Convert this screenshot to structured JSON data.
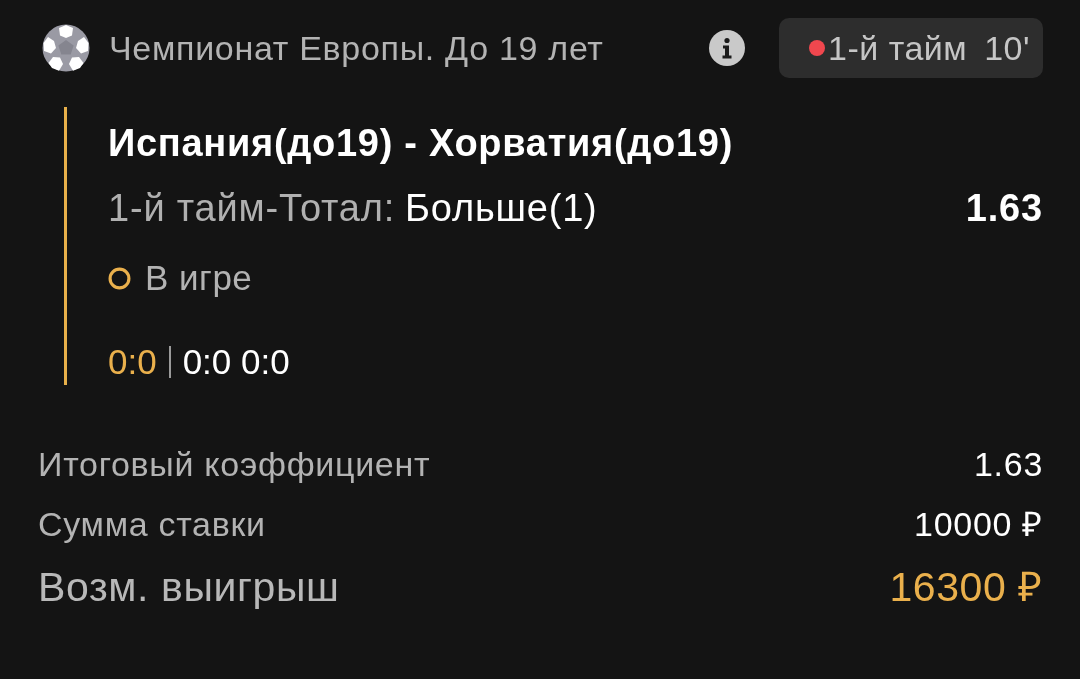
{
  "header": {
    "league": "Чемпионат Европы. До 19 лет",
    "live": {
      "on": true,
      "period": "1-й тайм",
      "minute": "10'"
    }
  },
  "bet": {
    "match": "Испания(до19) - Хорватия(до19)",
    "market": "1-й тайм-Тотал:",
    "outcome": "Больше(1)",
    "odds": "1.63",
    "status": "В игре",
    "score": {
      "current": "0:0",
      "periods": "0:0 0:0"
    }
  },
  "summary": [
    {
      "label": "Итоговый коэффициент",
      "value": "1.63",
      "kind": "plain"
    },
    {
      "label": "Сумма ставки",
      "value": "10000 ₽",
      "kind": "plain"
    },
    {
      "label": "Возм. выигрыш",
      "value": "16300 ₽",
      "kind": "total"
    }
  ]
}
